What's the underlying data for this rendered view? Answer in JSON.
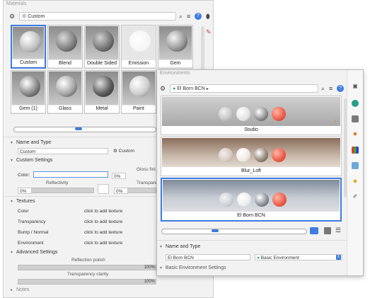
{
  "materials": {
    "title": "Materials",
    "selected_material": "Custom",
    "thumbnails": [
      {
        "label": "Custom",
        "selected": true
      },
      {
        "label": "Blend",
        "selected": false
      },
      {
        "label": "Double Sided",
        "selected": false
      },
      {
        "label": "Emission",
        "selected": false
      },
      {
        "label": "Gem",
        "selected": false
      },
      {
        "label": "Gem (1)",
        "selected": false
      },
      {
        "label": "Glass",
        "selected": false
      },
      {
        "label": "Metal",
        "selected": false
      },
      {
        "label": "Paint",
        "selected": false
      }
    ],
    "name_and_type": {
      "header": "Name and Type",
      "name_value": "Custom",
      "type_value": "Custom"
    },
    "custom_settings": {
      "header": "Custom Settings",
      "gloss_label": "Gloss fini",
      "color_label": "Color:",
      "color_percent": "0%",
      "reflectivity_label": "Reflectivity",
      "reflectivity_percent": "0%",
      "transparency_label": "Transpare",
      "transparency_percent": "0%"
    },
    "textures": {
      "header": "Textures",
      "rows": [
        {
          "label": "Color",
          "action": "click to add texture"
        },
        {
          "label": "Transparency",
          "action": "click to add texture"
        },
        {
          "label": "Bump / Normal",
          "action": "click to add texture"
        },
        {
          "label": "Environment",
          "action": "click to add texture"
        }
      ]
    },
    "advanced_settings": {
      "header": "Advanced Settings",
      "reflection_polish_label": "Reflection polish",
      "reflection_polish_value": "100%",
      "transparency_clarity_label": "Transparency clarity",
      "transparency_clarity_value": "100%"
    },
    "notes_header": "Notes"
  },
  "environments": {
    "title": "Environments",
    "selected_environment": "El Born BCN",
    "items": [
      {
        "label": "Studio",
        "selected": false
      },
      {
        "label": "Blur_Loft",
        "selected": false
      },
      {
        "label": "El Born BCN",
        "selected": true
      }
    ],
    "name_and_type": {
      "header": "Name and Type",
      "name_value": "El Born BCN",
      "type_value": "Basic Environment"
    },
    "basic_settings_header": "Basic Environment Settings"
  }
}
